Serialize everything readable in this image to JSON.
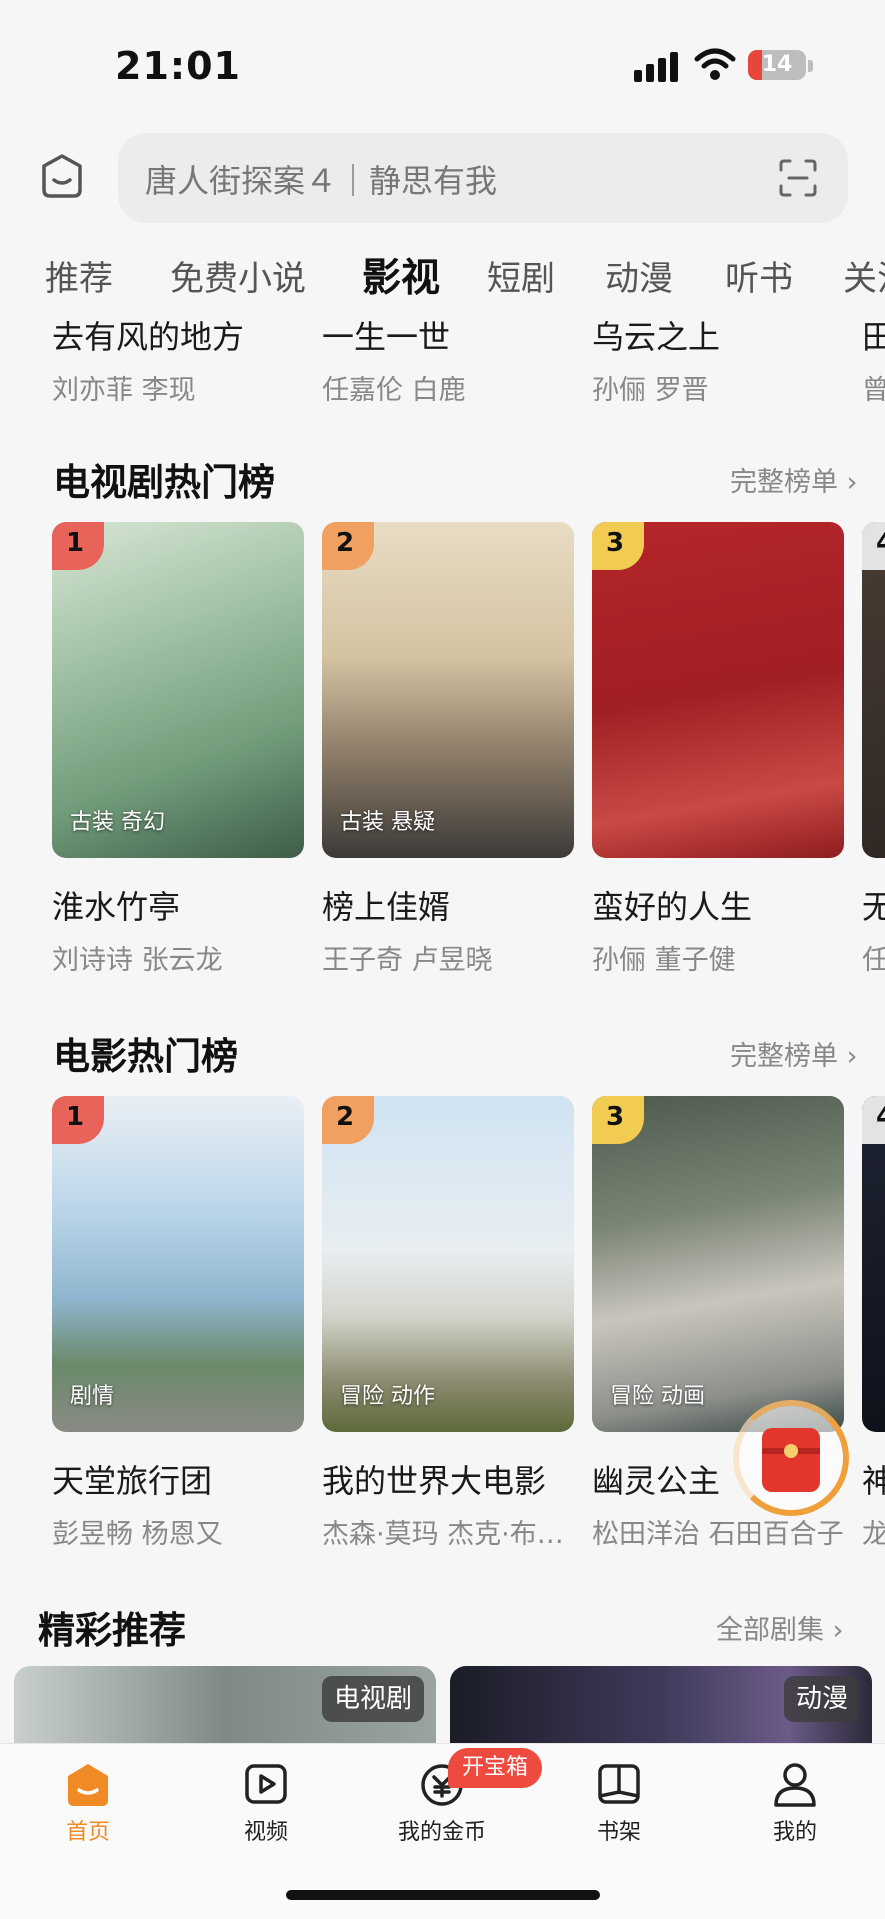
{
  "status_bar": {
    "time": "21:01",
    "battery": "14"
  },
  "search": {
    "placeholder": "唐人街探案４｜静思有我"
  },
  "tabs": [
    {
      "label": "推荐"
    },
    {
      "label": "免费小说"
    },
    {
      "label": "影视",
      "active": true
    },
    {
      "label": "短剧"
    },
    {
      "label": "动漫"
    },
    {
      "label": "听书"
    },
    {
      "label": "关注"
    }
  ],
  "previous_row": [
    {
      "title": "去有风的地方",
      "cast": "刘亦菲 李现"
    },
    {
      "title": "一生一世",
      "cast": "任嘉伦 白鹿"
    },
    {
      "title": "乌云之上",
      "cast": "孙俪 罗晋"
    },
    {
      "title": "田",
      "cast": "曾"
    }
  ],
  "tv_ranking": {
    "title": "电视剧热门榜",
    "more": "完整榜单",
    "items": [
      {
        "rank": "1",
        "tags": "古装 奇幻",
        "title": "淮水竹亭",
        "cast": "刘诗诗 张云龙"
      },
      {
        "rank": "2",
        "tags": "古装 悬疑",
        "title": "榜上佳婿",
        "cast": "王子奇 卢昱晓"
      },
      {
        "rank": "3",
        "tags": "",
        "title": "蛮好的人生",
        "cast": "孙俪 董子健"
      },
      {
        "rank": "4",
        "tags": "",
        "title": "无",
        "cast": "任"
      }
    ]
  },
  "movie_ranking": {
    "title": "电影热门榜",
    "more": "完整榜单",
    "items": [
      {
        "rank": "1",
        "tags": "剧情",
        "title": "天堂旅行团",
        "cast": "彭昱畅 杨恩又"
      },
      {
        "rank": "2",
        "tags": "冒险 动作",
        "title": "我的世界大电影",
        "cast": "杰森·莫玛 杰克·布莱克"
      },
      {
        "rank": "3",
        "tags": "冒险 动画",
        "title": "幽灵公主",
        "cast": "松田洋治 石田百合子"
      },
      {
        "rank": "4",
        "tags": "",
        "title": "神",
        "cast": "龙"
      }
    ]
  },
  "recommend": {
    "title": "精彩推荐",
    "more": "全部剧集",
    "cards": [
      {
        "badge": "电视剧"
      },
      {
        "badge": "动漫"
      }
    ]
  },
  "bottom_nav": {
    "items": [
      {
        "label": "首页",
        "icon": "home-icon",
        "active": true
      },
      {
        "label": "视频",
        "icon": "video-icon"
      },
      {
        "label": "我的金币",
        "icon": "coin-icon"
      },
      {
        "label": "书架",
        "icon": "bookshelf-icon"
      },
      {
        "label": "我的",
        "icon": "profile-icon"
      }
    ],
    "treasure_badge": "开宝箱"
  },
  "colors": {
    "accent": "#f08a24",
    "rank1": "#e8645a",
    "rank2": "#f0a060",
    "rank3": "#f2cc52",
    "badge_red": "#ef4a3f"
  }
}
